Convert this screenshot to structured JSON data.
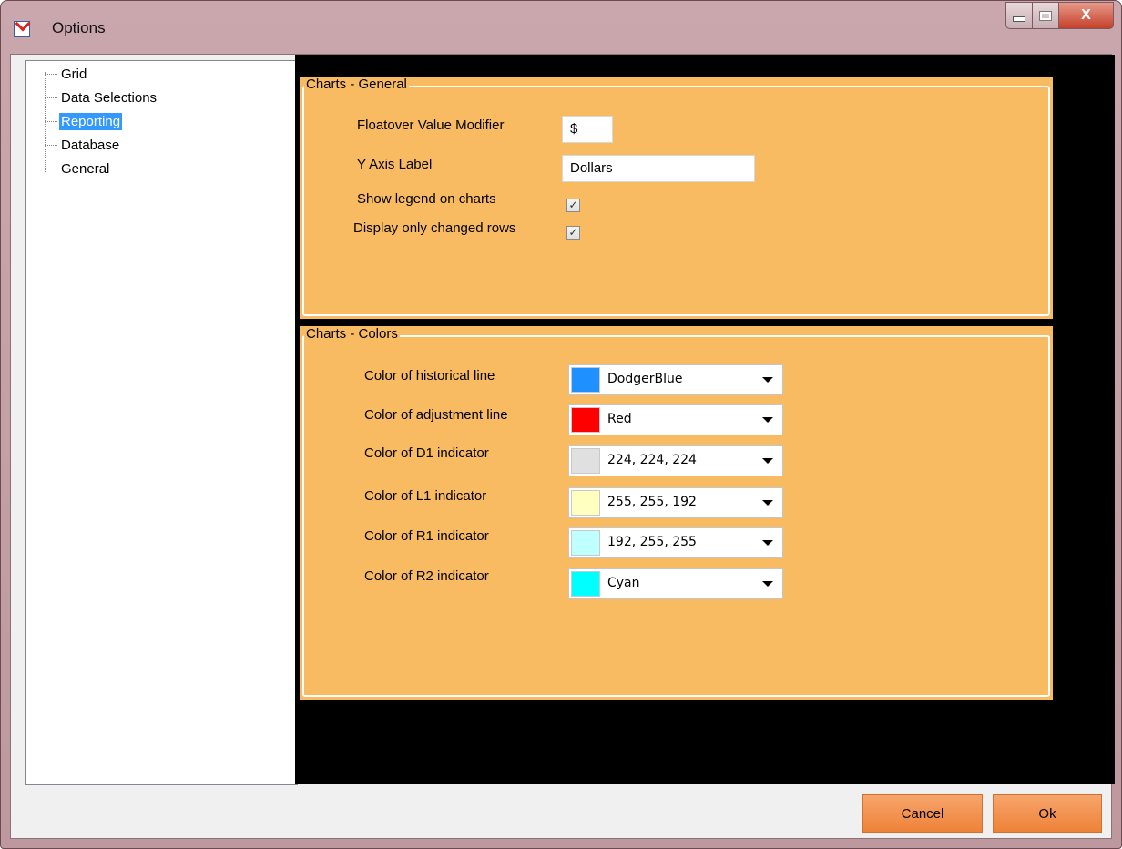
{
  "window": {
    "title": "Options",
    "close_glyph": "X",
    "icons": {
      "app": "options-app-icon",
      "minimize": "minimize-icon",
      "maximize": "maximize-icon",
      "close": "close-icon"
    }
  },
  "tree": {
    "items": [
      {
        "label": "Grid",
        "selected": false
      },
      {
        "label": "Data Selections",
        "selected": false
      },
      {
        "label": "Reporting",
        "selected": true
      },
      {
        "label": "Database",
        "selected": false
      },
      {
        "label": "General",
        "selected": false
      }
    ]
  },
  "general": {
    "title": "Charts - General",
    "floatover_label": "Floatover Value Modifier",
    "floatover_value": "$",
    "yaxis_label": "Y Axis Label",
    "yaxis_value": "Dollars",
    "legend_label": "Show legend on charts",
    "legend_checked": true,
    "changed_rows_label": "Display only changed rows",
    "changed_rows_checked": true,
    "check_glyph": "✓"
  },
  "colors": {
    "title": "Charts - Colors",
    "rows": [
      {
        "label": "Color of historical line",
        "value": "DodgerBlue",
        "swatch": "#1e90ff"
      },
      {
        "label": "Color of adjustment line",
        "value": "Red",
        "swatch": "#ff0000"
      },
      {
        "label": "Color of D1 indicator",
        "value": "224, 224, 224",
        "swatch": "#e0e0e0"
      },
      {
        "label": "Color of L1 indicator",
        "value": "255, 255, 192",
        "swatch": "#ffffc0"
      },
      {
        "label": "Color of R1 indicator",
        "value": "192, 255, 255",
        "swatch": "#c0ffff"
      },
      {
        "label": "Color of R2 indicator",
        "value": "Cyan",
        "swatch": "#00ffff"
      }
    ]
  },
  "buttons": {
    "cancel": "Cancel",
    "ok": "Ok"
  },
  "theme": {
    "panel": "#f9bb62",
    "button": "#f28c3e",
    "selection": "#3399ff"
  }
}
